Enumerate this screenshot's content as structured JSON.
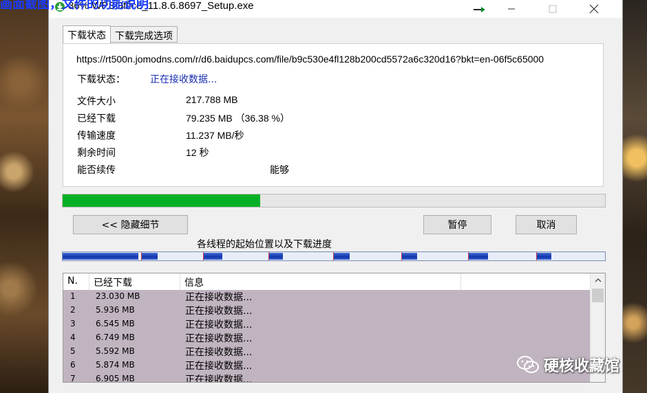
{
  "background_overlay_text": "画面截图，文件的功能说明",
  "window": {
    "title": "36% WPSOffice_11.8.6.8697_Setup.exe"
  },
  "tabs": [
    {
      "label": "下载状态"
    },
    {
      "label": "下载完成选项"
    }
  ],
  "status_panel": {
    "url": "https://rt500n.jomodns.com/r/d6.baidupcs.com/file/b9c530e4fl128b200cd5572a6c320d16?bkt=en-06f5c65000",
    "status_label": "下载状态：",
    "status_value": "正在接收数据...",
    "file_size_label": "文件大小",
    "file_size_value": "217.788  MB",
    "downloaded_label": "已经下载",
    "downloaded_value": "79.235  MB （36.38 %）",
    "speed_label": "传输速度",
    "speed_value": "11.237  MB/秒",
    "remaining_label": "剩余时间",
    "remaining_value": "12 秒",
    "resume_label": "能否续传",
    "resume_value": "能够"
  },
  "progress": {
    "fraction": 0.3638
  },
  "buttons": {
    "hide_details": "<< 隐藏细节",
    "pause": "暂停",
    "cancel": "取消"
  },
  "threads": {
    "caption": "各线程的起始位置以及下载进度",
    "segments": [
      {
        "start": 0.0,
        "fill": 0.14
      },
      {
        "start": 0.145,
        "fill": 0.03
      },
      {
        "start": 0.259,
        "fill": 0.035
      },
      {
        "start": 0.379,
        "fill": 0.027
      },
      {
        "start": 0.499,
        "fill": 0.03
      },
      {
        "start": 0.624,
        "fill": 0.03
      },
      {
        "start": 0.748,
        "fill": 0.036
      },
      {
        "start": 0.873,
        "fill": 0.028
      }
    ]
  },
  "list": {
    "columns": [
      "N.",
      "已经下载",
      "信息",
      ""
    ],
    "rows": [
      {
        "n": "1",
        "downloaded": "23.030  MB",
        "info": "正在接收数据..."
      },
      {
        "n": "2",
        "downloaded": "5.936  MB",
        "info": "正在接收数据..."
      },
      {
        "n": "3",
        "downloaded": "6.545  MB",
        "info": "正在接收数据..."
      },
      {
        "n": "4",
        "downloaded": "6.749  MB",
        "info": "正在接收数据..."
      },
      {
        "n": "5",
        "downloaded": "5.592  MB",
        "info": "正在接收数据..."
      },
      {
        "n": "6",
        "downloaded": "5.874  MB",
        "info": "正在接收数据..."
      },
      {
        "n": "7",
        "downloaded": "6.905  MB",
        "info": "正在接收数据..."
      }
    ]
  },
  "watermark": {
    "text": "硬核收藏馆"
  },
  "colors": {
    "progress_green": "#06b025",
    "status_blue": "#1a2fb0",
    "row_bg": "#c0b4c0",
    "thread_blue": "#1233a8"
  }
}
